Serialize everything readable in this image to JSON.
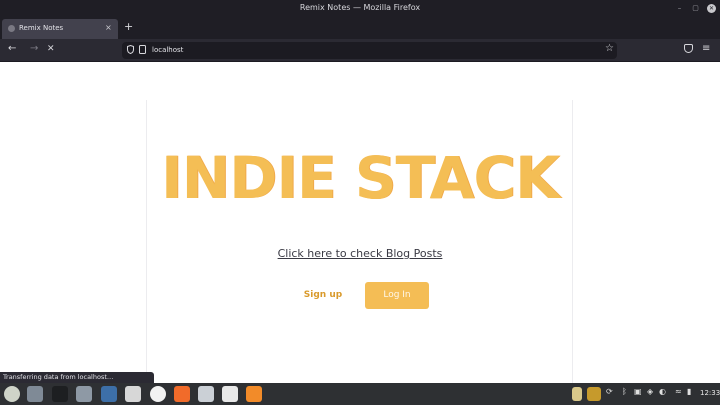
{
  "window": {
    "title": "Remix Notes — Mozilla Firefox"
  },
  "tabs": [
    {
      "title": "Remix Notes",
      "close": "×"
    }
  ],
  "new_tab": "+",
  "nav": {
    "back": "←",
    "forward": "→",
    "stop": "✕",
    "star": "☆",
    "menu": "≡"
  },
  "urlbar": {
    "url": "localhost"
  },
  "page": {
    "title": "INDIE STACK",
    "blog_link": "Click here to check Blog Posts",
    "signup_label": "Sign up",
    "login_label": "Log In"
  },
  "status_bar": {
    "text": "Transferring data from localhost…"
  },
  "taskbar": {
    "clock": "12:33",
    "apps": [
      "menu-icon",
      "files-icon",
      "terminal-icon",
      "folder-icon",
      "vscode-icon",
      "desktop-icon",
      "chrome-icon",
      "brave-icon",
      "notes-icon",
      "skype-icon",
      "firefox-icon"
    ]
  },
  "colors": {
    "accent": "#f4be55",
    "link": "#3a3a44",
    "titlebar": "#1f1e25",
    "toolbar": "#2b2a33"
  }
}
